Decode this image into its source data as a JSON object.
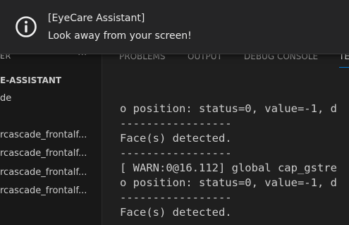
{
  "sidebar": {
    "header_label": "ER",
    "more_glyph": "···",
    "folder_title": "E-ASSISTANT",
    "items": [
      {
        "label": "de"
      },
      {
        "label": "rcascade_frontalf..."
      },
      {
        "label": "rcascade_frontalf..."
      },
      {
        "label": "rcascade_frontalf..."
      },
      {
        "label": "rcascade_frontalf..."
      }
    ]
  },
  "panel": {
    "tabs": [
      {
        "label": "PROBLEMS"
      },
      {
        "label": "OUTPUT"
      },
      {
        "label": "DEBUG CONSOLE"
      },
      {
        "label": "TE"
      }
    ],
    "terminal_lines": [
      "o position: status=0, value=-1, d",
      "-----------------",
      "Face(s) detected.",
      "-----------------",
      "[ WARN:0@16.112] global cap_gstre",
      "o position: status=0, value=-1, d",
      "-----------------",
      "Face(s) detected."
    ]
  },
  "notification": {
    "title": "[EyeCare Assistant]",
    "message": "Look away from your screen!",
    "icon": "info-icon"
  },
  "colors": {
    "accent": "#0078d4",
    "background": "#1f1f1f",
    "toast_background": "#252526"
  }
}
